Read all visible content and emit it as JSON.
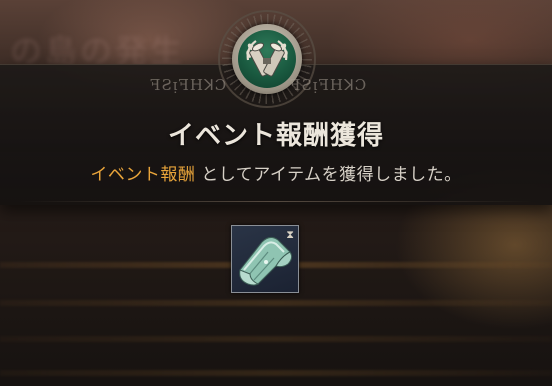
{
  "background": {
    "blurred_text": "の島の発生"
  },
  "banner": {
    "emblem_icon": "crossed-scrolls-laurel-icon",
    "rune_left": "ꟻƧᴉꟻHꓘƆ",
    "rune_right": "ꟻƧᴉꟻHꓘƆ",
    "title": "イベント報酬獲得",
    "subtitle_highlight": "イベント報酬",
    "subtitle_rest": " としてアイテムを獲得しました。"
  },
  "reward": {
    "item_icon": "scroll-map-icon",
    "timer_icon": "hourglass-icon",
    "timer_glyph": "⧗"
  },
  "colors": {
    "highlight": "#e8a43a",
    "title": "#ece6dc",
    "emblem_green": "#1a5a40"
  }
}
